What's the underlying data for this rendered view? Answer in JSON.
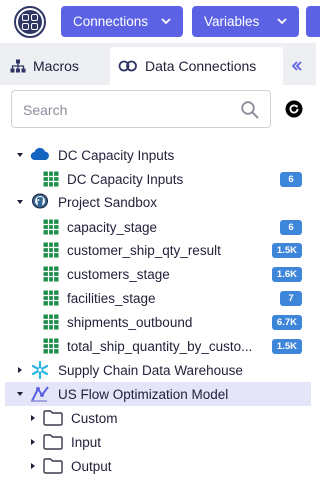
{
  "toolbar": {
    "apps_icon": "apps-grid-icon",
    "connections_label": "Connections",
    "variables_label": "Variables",
    "button_color": "#5b63e4"
  },
  "tabs": {
    "macros_label": "Macros",
    "data_connections_label": "Data Connections",
    "active": "Data Connections"
  },
  "search": {
    "placeholder": "Search",
    "value": ""
  },
  "tree": {
    "items": [
      {
        "label": "DC Capacity Inputs",
        "icon": "cloud-icon",
        "expanded": true
      },
      {
        "label": "DC Capacity Inputs",
        "icon": "table-icon",
        "badge": "6"
      },
      {
        "label": "Project Sandbox",
        "icon": "postgres-icon",
        "expanded": true
      },
      {
        "label": "capacity_stage",
        "icon": "table-icon",
        "badge": "6"
      },
      {
        "label": "customer_ship_qty_result",
        "icon": "table-icon",
        "badge": "1.5K"
      },
      {
        "label": "customers_stage",
        "icon": "table-icon",
        "badge": "1.6K"
      },
      {
        "label": "facilities_stage",
        "icon": "table-icon",
        "badge": "7"
      },
      {
        "label": "shipments_outbound",
        "icon": "table-icon",
        "badge": "6.7K"
      },
      {
        "label": "total_ship_quantity_by_custo...",
        "icon": "table-icon",
        "badge": "1.5K"
      },
      {
        "label": "Supply Chain Data Warehouse",
        "icon": "snowflake-icon",
        "expanded": false
      },
      {
        "label": "US Flow Optimization Model",
        "icon": "model-icon",
        "expanded": true,
        "selected": true
      },
      {
        "label": "Custom",
        "icon": "folder-icon",
        "expanded": false
      },
      {
        "label": "Input",
        "icon": "folder-icon",
        "expanded": false
      },
      {
        "label": "Output",
        "icon": "folder-icon",
        "expanded": false
      }
    ]
  },
  "colors": {
    "badge": "#3e86d9",
    "table_icon": "#1e8e4a",
    "selected_row": "#e4e5f8",
    "cloud": "#1565c0",
    "snowflake": "#29b5e8"
  }
}
